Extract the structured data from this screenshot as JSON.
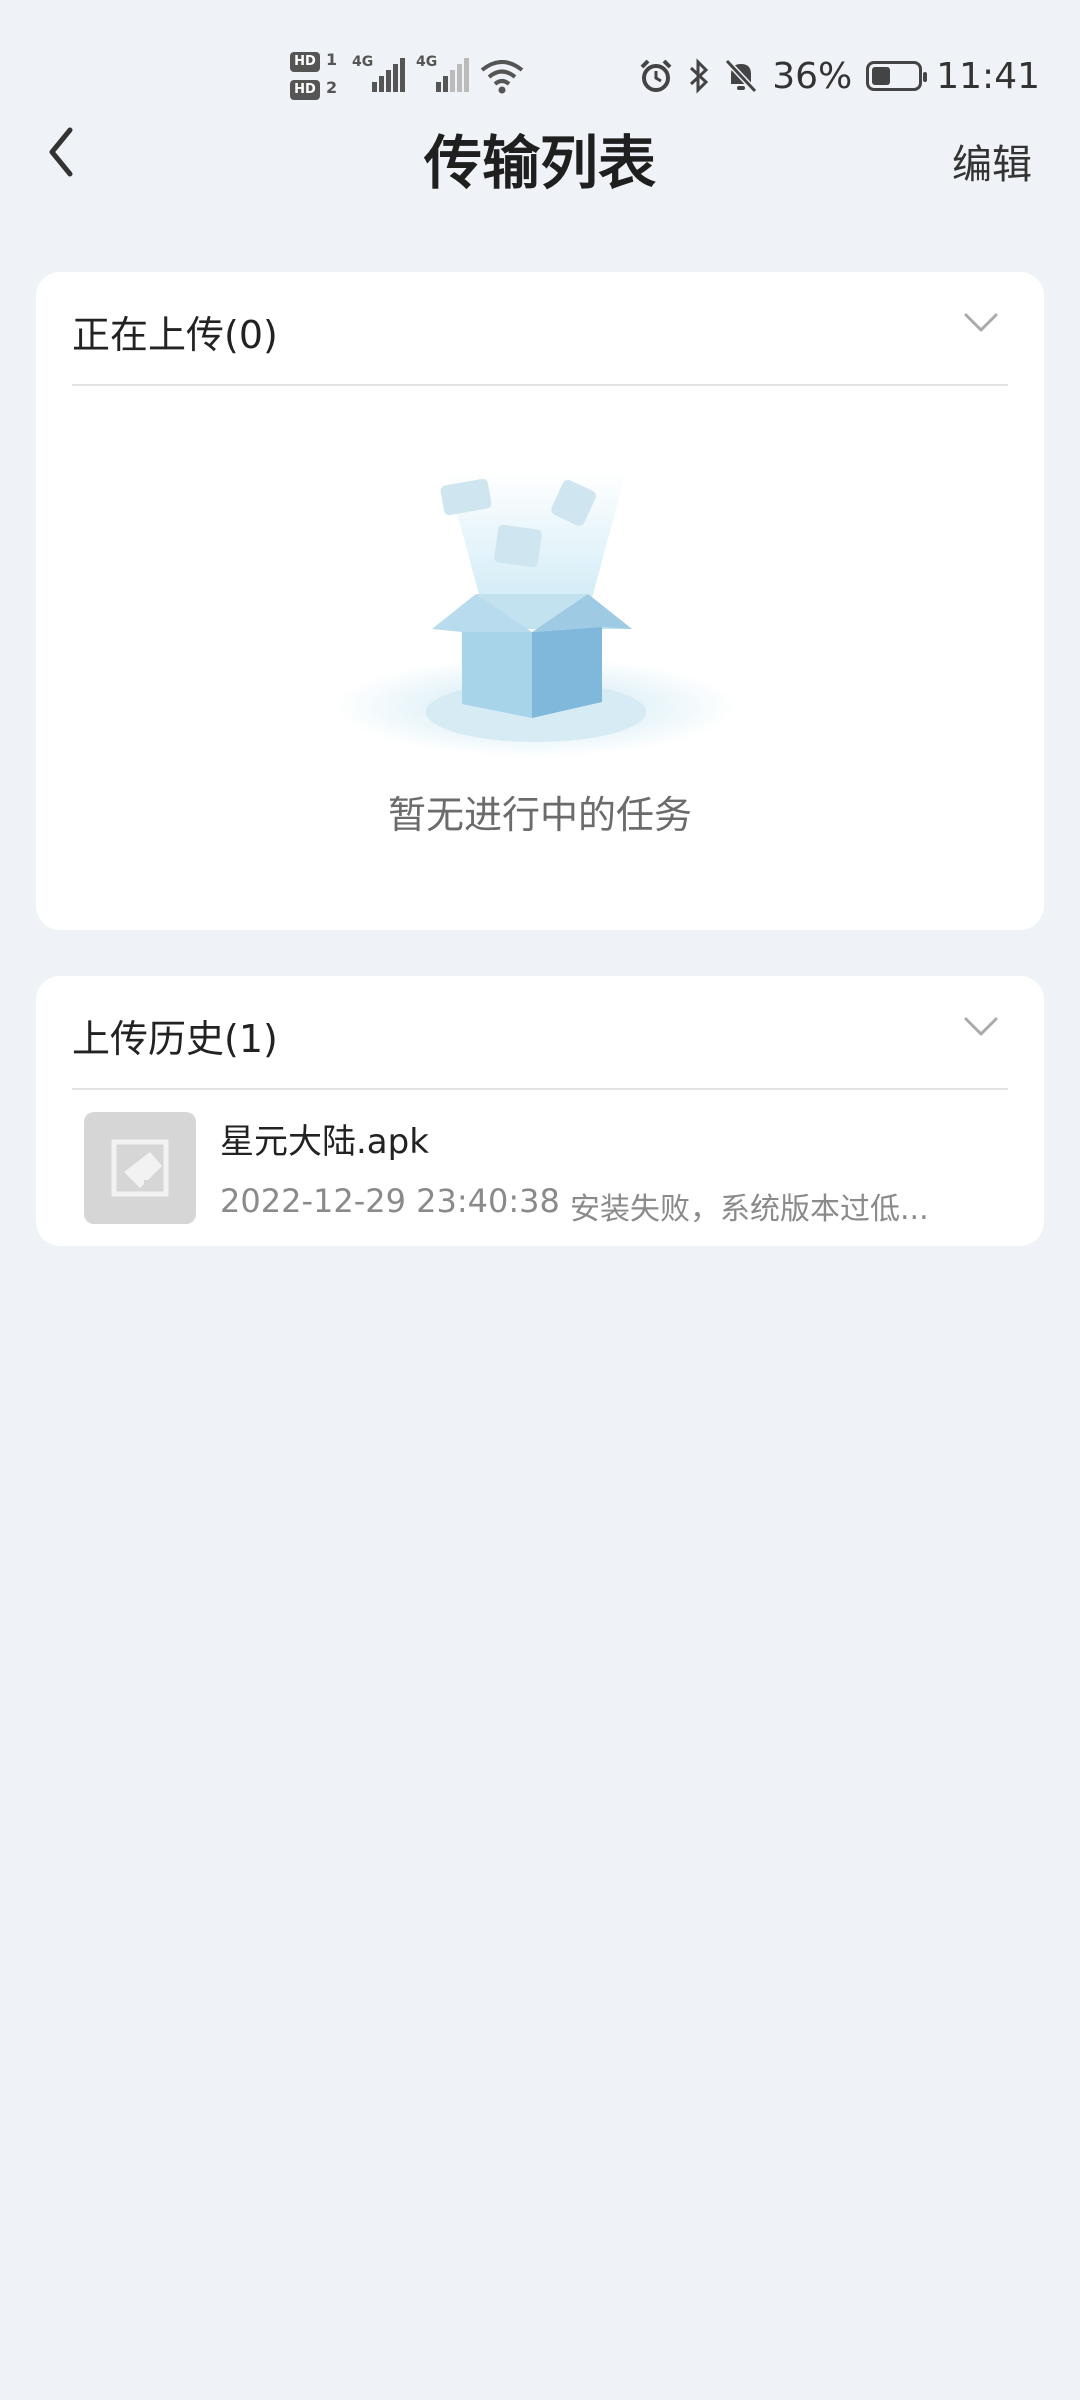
{
  "status_bar": {
    "sim1_label": "HD",
    "sim1_num": "1",
    "sim2_label": "HD",
    "sim2_num": "2",
    "signal1": "4G",
    "signal2": "4G",
    "battery": "36%",
    "battery_level": 0.36,
    "time": "11:41",
    "icons": [
      "alarm-icon",
      "bluetooth-icon",
      "mute-icon",
      "battery-icon",
      "wifi-icon"
    ]
  },
  "header": {
    "title": "传输列表",
    "edit_label": "编辑"
  },
  "uploading": {
    "title": "正在上传(0)",
    "empty_text": "暂无进行中的任务"
  },
  "history": {
    "title": "上传历史(1)",
    "items": [
      {
        "name": "星元大陆.apk",
        "time": "2022-12-29 23:40:38",
        "status": "安装失败，系统版本过低..."
      }
    ]
  }
}
